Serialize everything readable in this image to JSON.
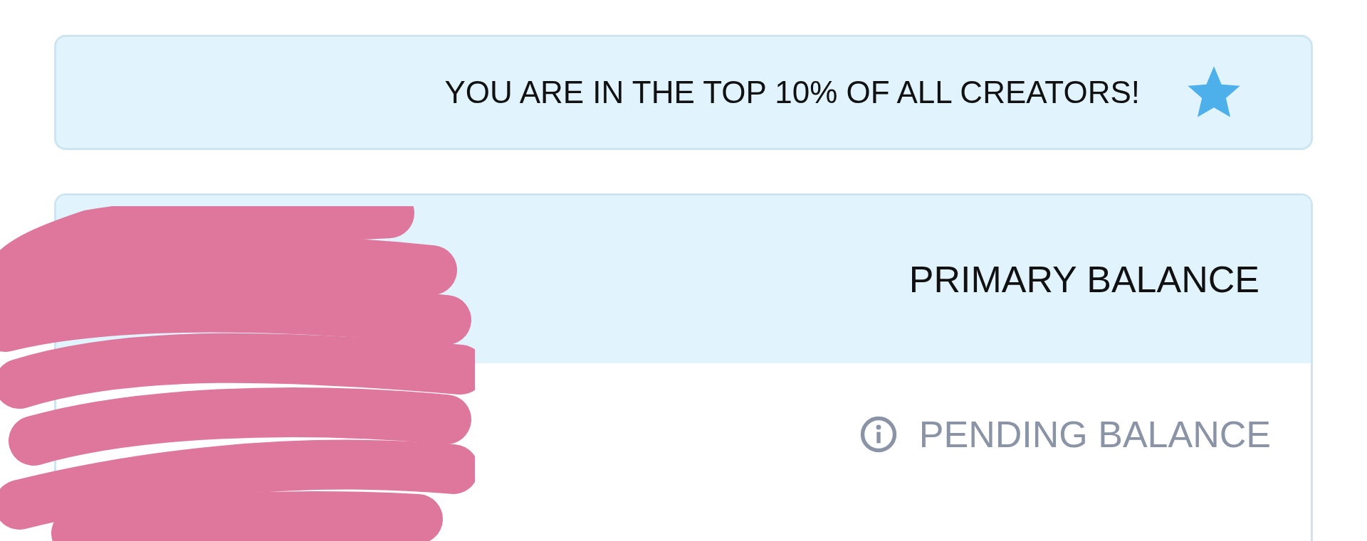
{
  "banner": {
    "text": "YOU ARE IN THE TOP 10% OF ALL CREATORS!"
  },
  "balance_card": {
    "header": "PRIMARY BALANCE",
    "rows": [
      {
        "label": "PENDING BALANCE",
        "kind": "info"
      }
    ]
  },
  "redaction": {
    "kind": "scribble"
  }
}
